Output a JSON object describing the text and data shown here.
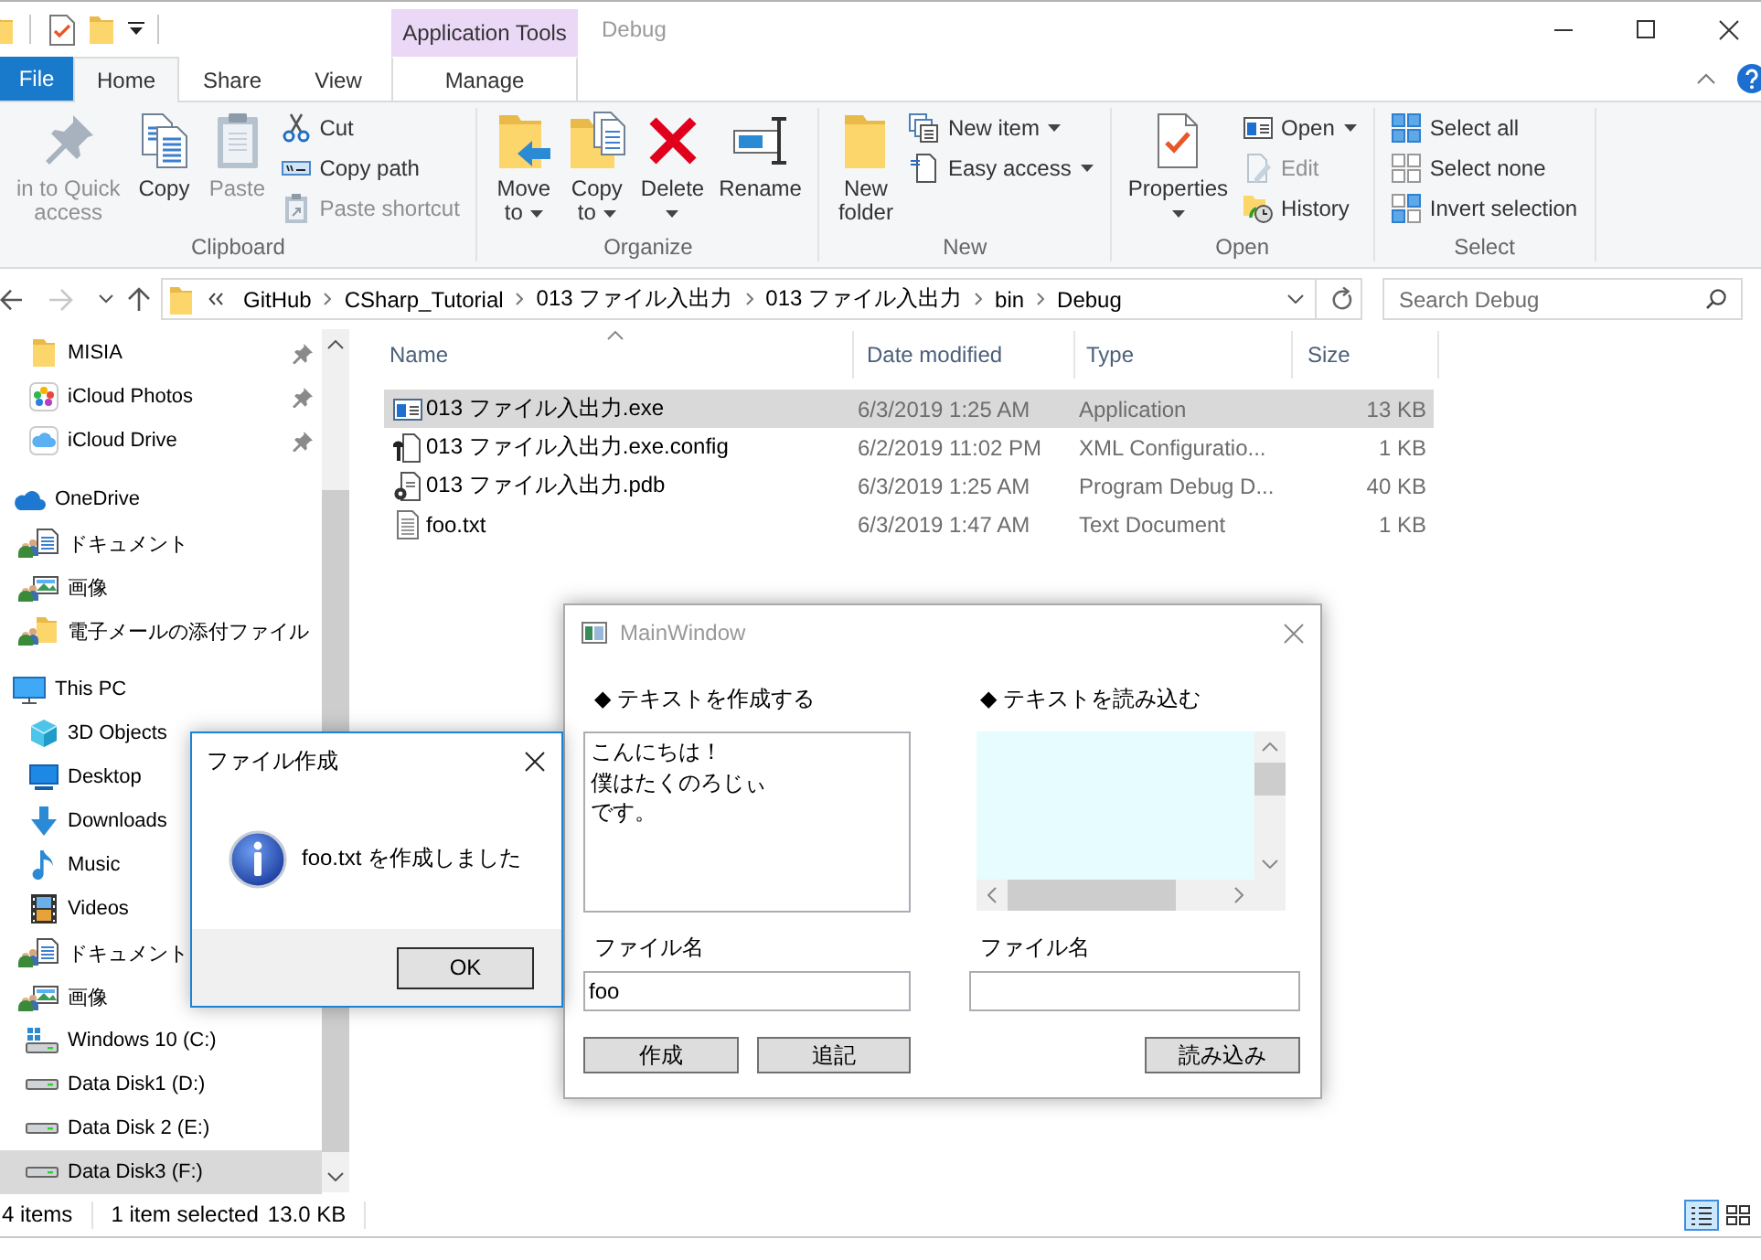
{
  "title_bar": {
    "context_header": "Application Tools",
    "title": "Debug",
    "active": false
  },
  "ribbon_tabs": [
    {
      "label": "File",
      "kind": "file",
      "selected": false
    },
    {
      "label": "Home",
      "kind": "tab",
      "selected": true
    },
    {
      "label": "Share",
      "kind": "tab",
      "selected": false
    },
    {
      "label": "View",
      "kind": "tab",
      "selected": false
    },
    {
      "label": "Manage",
      "kind": "context",
      "selected": false
    }
  ],
  "ribbon": {
    "groups": [
      {
        "label": "Clipboard",
        "columns": [
          [
            {
              "label": "in to Quick\naccess",
              "kind": "pin",
              "disabled": true,
              "dropdown": false
            }
          ],
          [
            {
              "label": "Copy",
              "kind": "copy",
              "disabled": false,
              "dropdown": false
            }
          ],
          [
            {
              "label": "Paste",
              "kind": "paste",
              "disabled": true,
              "dropdown": false
            }
          ],
          [
            {
              "label": "Cut",
              "kind": "cut",
              "disabled": false,
              "dropdown": false
            },
            {
              "label": "Copy path",
              "kind": "copy_path",
              "disabled": false,
              "dropdown": false
            },
            {
              "label": "Paste shortcut",
              "kind": "paste_shortcut",
              "disabled": true,
              "dropdown": false
            }
          ]
        ]
      },
      {
        "label": "Organize",
        "columns": [
          [
            {
              "label": "Move\nto",
              "kind": "move_to",
              "disabled": false,
              "dropdown": true
            }
          ],
          [
            {
              "label": "Copy\nto",
              "kind": "copy_to",
              "disabled": false,
              "dropdown": true
            }
          ],
          [
            {
              "label": "Delete",
              "kind": "delete",
              "disabled": false,
              "dropdown": true
            }
          ],
          [
            {
              "label": "Rename",
              "kind": "rename",
              "disabled": false,
              "dropdown": false
            }
          ]
        ]
      },
      {
        "label": "New",
        "columns": [
          [
            {
              "label": "New\nfolder",
              "kind": "new_folder",
              "disabled": false,
              "dropdown": false
            }
          ],
          [
            {
              "label": "New item",
              "kind": "new_item",
              "disabled": false,
              "dropdown": true
            },
            {
              "label": "Easy access",
              "kind": "easy_access",
              "disabled": false,
              "dropdown": true
            }
          ]
        ]
      },
      {
        "label": "Open",
        "columns": [
          [
            {
              "label": "Properties",
              "kind": "properties",
              "disabled": false,
              "dropdown": true
            }
          ],
          [
            {
              "label": "Open",
              "kind": "open",
              "disabled": false,
              "dropdown": true
            },
            {
              "label": "Edit",
              "kind": "edit",
              "disabled": true,
              "dropdown": false
            },
            {
              "label": "History",
              "kind": "history",
              "disabled": false,
              "dropdown": false
            }
          ]
        ]
      },
      {
        "label": "Select",
        "columns": [
          [
            {
              "label": "Select all",
              "kind": "select_all",
              "disabled": false,
              "dropdown": false
            },
            {
              "label": "Select none",
              "kind": "select_none",
              "disabled": false,
              "dropdown": false
            },
            {
              "label": "Invert selection",
              "kind": "invert_selection",
              "disabled": false,
              "dropdown": false
            }
          ]
        ]
      }
    ]
  },
  "address_bar": {
    "buttons": [
      {
        "kind": "back",
        "disabled": false
      },
      {
        "kind": "forward",
        "disabled": true
      },
      {
        "kind": "recent",
        "disabled": false
      },
      {
        "kind": "up",
        "disabled": false
      }
    ],
    "path": [
      "GitHub",
      "CSharp_Tutorial",
      "013 ファイル入出力",
      "013 ファイル入出力",
      "bin",
      "Debug"
    ]
  },
  "search": {
    "placeholder": "Search Debug"
  },
  "navigation_pane": {
    "pinned_items": [
      {
        "label": "MISIA",
        "kind": "folder",
        "pinned": true,
        "selected": false
      },
      {
        "label": "iCloud Photos",
        "kind": "photos",
        "pinned": true,
        "selected": false
      },
      {
        "label": "iCloud Drive",
        "kind": "icloud",
        "pinned": true,
        "selected": false
      }
    ],
    "tree": [
      {
        "label": "OneDrive",
        "kind": "onedrive",
        "selected": false,
        "children": [
          {
            "label": "ドキュメント",
            "kind": "shared_documents",
            "selected": false
          },
          {
            "label": "画像",
            "kind": "shared_pictures",
            "selected": false
          },
          {
            "label": "電子メールの添付ファイル",
            "kind": "shared_folder",
            "selected": false
          }
        ]
      },
      {
        "label": "This PC",
        "kind": "pc",
        "selected": false,
        "children": [
          {
            "label": "3D Objects",
            "kind": "objects3d",
            "selected": false
          },
          {
            "label": "Desktop",
            "kind": "desktop",
            "selected": false
          },
          {
            "label": "Downloads",
            "kind": "downloads",
            "selected": false
          },
          {
            "label": "Music",
            "kind": "music",
            "selected": false
          },
          {
            "label": "Videos",
            "kind": "videos",
            "selected": false
          },
          {
            "label": "ドキュメント",
            "kind": "shared_documents",
            "selected": false
          },
          {
            "label": "画像",
            "kind": "shared_pictures",
            "selected": false
          },
          {
            "label": "Windows 10 (C:)",
            "kind": "system_drive",
            "selected": false
          },
          {
            "label": "Data Disk1 (D:)",
            "kind": "drive",
            "selected": false
          },
          {
            "label": "Data Disk 2 (E:)",
            "kind": "drive",
            "selected": false
          },
          {
            "label": "Data Disk3 (F:)",
            "kind": "drive",
            "selected": true
          }
        ]
      }
    ]
  },
  "file_list": {
    "columns": [
      {
        "label": "Name",
        "sorted": true
      },
      {
        "label": "Date modified",
        "sorted": false
      },
      {
        "label": "Type",
        "sorted": false
      },
      {
        "label": "Size",
        "sorted": false
      }
    ],
    "rows": [
      {
        "kind": "exe",
        "name": "013 ファイル入出力.exe",
        "date_modified": "6/3/2019 1:25 AM",
        "type": "Application",
        "size": "13 KB",
        "selected": true
      },
      {
        "kind": "config",
        "name": "013 ファイル入出力.exe.config",
        "date_modified": "6/2/2019 11:02 PM",
        "type": "XML Configuratio...",
        "size": "1 KB",
        "selected": false
      },
      {
        "kind": "pdb",
        "name": "013 ファイル入出力.pdb",
        "date_modified": "6/3/2019 1:25 AM",
        "type": "Program Debug D...",
        "size": "40 KB",
        "selected": false
      },
      {
        "kind": "txt",
        "name": "foo.txt",
        "date_modified": "6/3/2019 1:47 AM",
        "type": "Text Document",
        "size": "1 KB",
        "selected": false
      }
    ]
  },
  "status_bar": {
    "item_count": "4 items",
    "selection": "1 item selected",
    "selection_size": "13.0 KB",
    "views": [
      {
        "kind": "details",
        "selected": true
      },
      {
        "kind": "large_icons",
        "selected": false
      }
    ]
  },
  "main_window": {
    "title": "MainWindow",
    "active": false,
    "write_section": {
      "heading": "◆ テキストを作成する",
      "lines": [
        "こんにちは！",
        "僕はたくのろじぃ",
        "です。"
      ],
      "filename_label": "ファイル名",
      "filename": "foo",
      "buttons": [
        "作成",
        "追記"
      ]
    },
    "read_section": {
      "heading": "◆ テキストを読み込む",
      "filename_label": "ファイル名",
      "buttons": [
        "読み込み"
      ]
    }
  },
  "message_box": {
    "title": "ファイル作成",
    "active": true,
    "message": "foo.txt を作成しました",
    "button": "OK"
  }
}
